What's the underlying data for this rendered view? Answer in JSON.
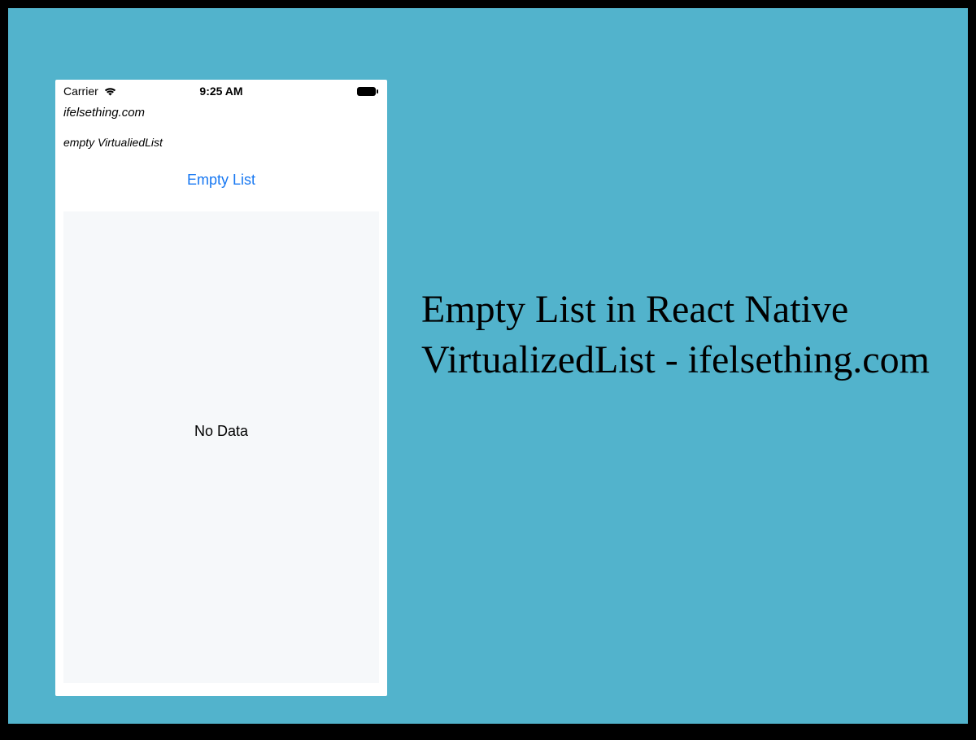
{
  "statusBar": {
    "carrier": "Carrier",
    "time": "9:25 AM"
  },
  "app": {
    "siteName": "ifelsething.com",
    "subtitle": "empty VirtualiedList",
    "emptyListButtonLabel": "Empty List",
    "noDataText": "No Data"
  },
  "headline": "Empty List in React Native VirtualizedList - ifelsething.com"
}
